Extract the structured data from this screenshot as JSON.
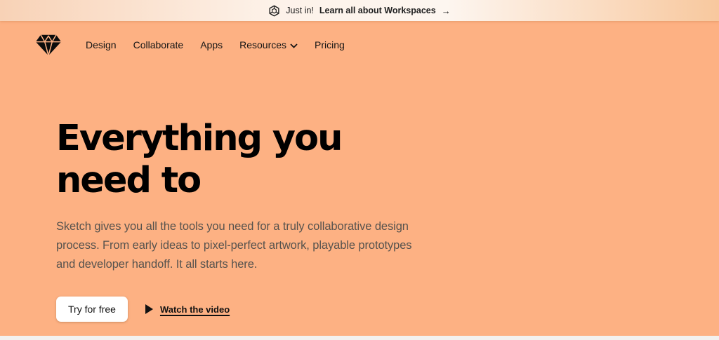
{
  "banner": {
    "icon": "workspaces-hexagon-icon",
    "prefix": "Just in!",
    "link_text": "Learn all about Workspaces",
    "arrow": "→"
  },
  "nav": {
    "logo": "sketch-diamond-logo",
    "items": [
      {
        "label": "Design",
        "has_dropdown": false
      },
      {
        "label": "Collaborate",
        "has_dropdown": false
      },
      {
        "label": "Apps",
        "has_dropdown": false
      },
      {
        "label": "Resources",
        "has_dropdown": true
      },
      {
        "label": "Pricing",
        "has_dropdown": false
      }
    ]
  },
  "hero": {
    "heading_line1": "Everything you",
    "heading_line2": "need to",
    "paragraph_line1": "Sketch gives you all the tools you need for a truly collaborative design",
    "paragraph_line2": "process. From early ideas to pixel-perfect artwork, playable prototypes",
    "paragraph_line3": "and developer handoff. It all starts here.",
    "primary_cta": "Try for free",
    "video_cta": "Watch the video"
  },
  "colors": {
    "hero_background": "#fdb183",
    "heading_text": "#000000",
    "body_text": "#57534e",
    "banner_text": "#1d1d1d",
    "button_background": "#ffffff"
  }
}
